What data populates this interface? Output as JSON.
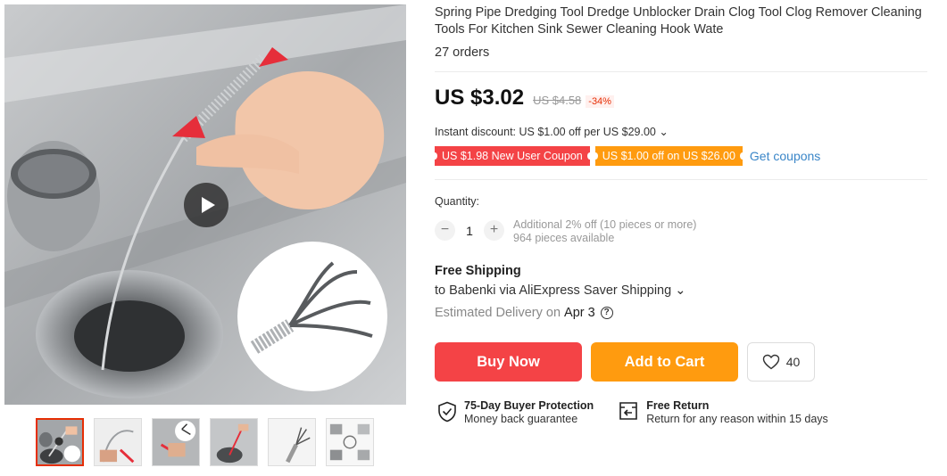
{
  "product": {
    "title": "Spring Pipe Dredging Tool Dredge Unblocker Drain Clog Tool Clog Remover Cleaning Tools For Kitchen Sink Sewer Cleaning Hook Wate",
    "orders": "27 orders"
  },
  "price": {
    "current": "US $3.02",
    "original": "US $4.58",
    "discount": "-34%"
  },
  "instant_discount": "Instant discount: US $1.00 off per US $29.00 ⌄",
  "coupons": {
    "new_user": "US $1.98 New User Coupon",
    "store": "US $1.00 off on US $26.00",
    "get_label": "Get coupons"
  },
  "quantity": {
    "label": "Quantity:",
    "value": "1",
    "minus": "−",
    "plus": "+",
    "bulk_note": "Additional 2% off (10 pieces or more)",
    "available": "964 pieces available"
  },
  "shipping": {
    "title": "Free Shipping",
    "to": "to Babenki via AliExpress Saver Shipping ⌄",
    "estimated_label": "Estimated Delivery on",
    "date": "Apr 3",
    "help": "?"
  },
  "actions": {
    "buy_now": "Buy Now",
    "add_to_cart": "Add to Cart",
    "wish_count": "40"
  },
  "guarantees": {
    "protection_title": "75-Day Buyer Protection",
    "protection_sub": "Money back guarantee",
    "return_title": "Free Return",
    "return_sub": "Return for any reason within 15 days"
  },
  "colors": {
    "buy": "#f44346",
    "cart": "#ff9b0f",
    "link": "#3a86c8",
    "active_thumb_border": "#e62e04"
  },
  "icons": {
    "play": "play-icon",
    "wish": "heart-icon",
    "protection": "shield-check-icon",
    "return": "return-box-icon"
  }
}
